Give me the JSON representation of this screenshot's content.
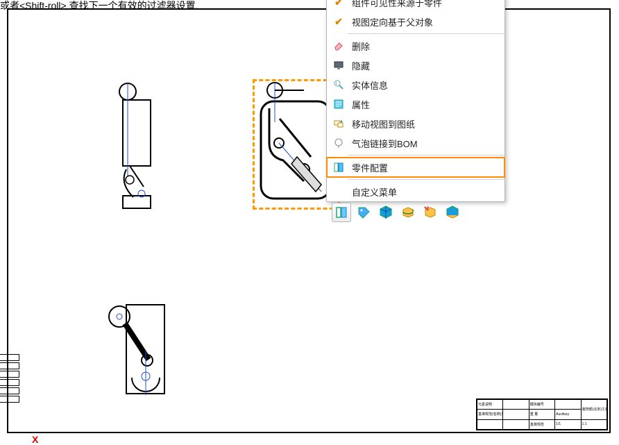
{
  "hint_text": "或者<Shift-roll> 查找下一个有效的过滤器设置.",
  "context_menu": {
    "items": [
      {
        "label": "组件可见性来源于零件",
        "checked": true,
        "icon": "check-icon"
      },
      {
        "label": "视图定向基于父对象",
        "checked": true,
        "icon": "check-icon"
      },
      {
        "sep": true
      },
      {
        "label": "删除",
        "icon": "eraser-icon"
      },
      {
        "label": "隐藏",
        "icon": "monitor-icon"
      },
      {
        "label": "实体信息",
        "icon": "info-icon"
      },
      {
        "label": "属性",
        "icon": "properties-icon"
      },
      {
        "label": "移动视图到图纸",
        "icon": "move-view-icon"
      },
      {
        "label": "气泡链接到BOM",
        "icon": "balloon-icon"
      },
      {
        "sep": true
      },
      {
        "label": "零件配置",
        "icon": "part-config-icon",
        "highlight": true
      },
      {
        "sep": true
      },
      {
        "label": "自定义菜单",
        "icon": ""
      }
    ]
  },
  "toolbar_icons": [
    "sheet-select-icon",
    "tag-icon",
    "cube-blue-icon",
    "rotate-view-icon",
    "new-view-icon",
    "cube-bottom-icon"
  ],
  "title_block": {
    "r1c1": "元素说明",
    "r1c2": "",
    "r1c3": "模块编号",
    "r1c4": "",
    "r1c5": "装饰部(北京)工业设备有限公司",
    "r2c1": "基准规范(名称)产品规格编号",
    "r2c2": "",
    "r2c3": "重 量",
    "r2c4": "Auxiliary",
    "r2c5": "",
    "r3c1": "",
    "r3c2": "",
    "r3c3": "基准规范",
    "r3c4": "",
    "r3c5": "",
    "r4c1": "",
    "r4c2": "",
    "r4c3": "",
    "r4c4": "1/1",
    "r4c5": "1:1"
  },
  "cursor_label": "X"
}
